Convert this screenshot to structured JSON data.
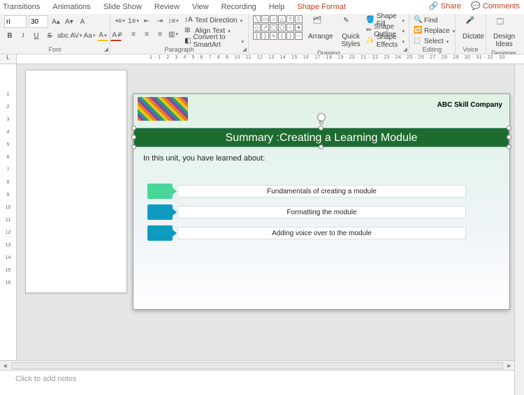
{
  "ribbon_tabs": {
    "transitions": "Transitions",
    "animations": "Animations",
    "slide_show": "Slide Show",
    "review": "Review",
    "view": "View",
    "recording": "Recording",
    "help": "Help",
    "shape_format": "Shape Format"
  },
  "top_right": {
    "share": "Share",
    "comments": "Comments"
  },
  "font_group": {
    "label": "Font",
    "font_name": "ri",
    "font_size": "30",
    "inc": "A▴",
    "dec": "A▾",
    "clear": "A",
    "bold": "B",
    "italic": "I",
    "underline": "U",
    "strike": "S",
    "shadow": "abc",
    "spacing": "AV",
    "case": "Aa",
    "color": "A",
    "highlight": "A"
  },
  "paragraph_group": {
    "label": "Paragraph",
    "text_direction": "Text Direction",
    "align_text": "Align Text",
    "smartart": "Convert to SmartArt"
  },
  "drawing_group": {
    "label": "Drawing",
    "arrange": "Arrange",
    "quick_styles": "Quick\nStyles",
    "shape_fill": "Shape Fill",
    "shape_outline": "Shape Outline",
    "shape_effects": "Shape Effects"
  },
  "editing_group": {
    "label": "Editing",
    "find": "Find",
    "replace": "Replace",
    "select": "Select"
  },
  "voice_group": {
    "label": "Voice",
    "dictate": "Dictate"
  },
  "designer_group": {
    "label": "Designer",
    "ideas": "Design\nIdeas"
  },
  "ruler_h": "1 · 1 · 2 · 3 · 4 · 5 · 6 · 7 · 8 · 9 · 10 · 11 · 12 · 13 · 14 · 15 · 16 · 17 · 18 · 19 · 20 · 21 · 22 · 23 · 24 · 25 · 26 · 27 · 28 · 29 · 30 · 31 · 32 · 33",
  "ruler_v": [
    "1",
    "2",
    "3",
    "4",
    "5",
    "6",
    "7",
    "8",
    "9",
    "10",
    "11",
    "12",
    "13",
    "14",
    "15",
    "16"
  ],
  "slide": {
    "company": "ABC Skill Company",
    "title": "Summary :Creating a Learning Module",
    "intro": "In this unit, you have learned about:",
    "bullets": [
      "Fundamentals of creating a module",
      "Formatting the module",
      "Adding voice over to the module"
    ]
  },
  "notes_placeholder": "Click to add notes",
  "ruler_stub": "L"
}
